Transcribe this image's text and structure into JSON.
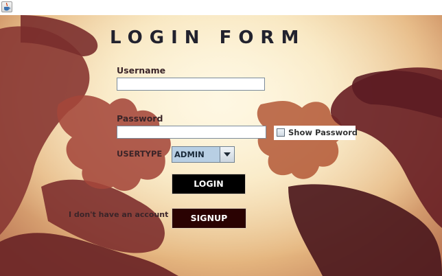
{
  "window": {
    "icon": "java-cup-icon"
  },
  "form": {
    "title": "LOGIN FORM",
    "username_label": "Username",
    "username_value": "",
    "password_label": "Password",
    "password_value": "",
    "show_password_label": "Show Password",
    "show_password_checked": false,
    "usertype_label": "USERTYPE",
    "usertype_selected": "ADMIN",
    "login_label": "LOGIN",
    "account_prompt": "I don't have an account",
    "signup_label": "SIGNUP"
  },
  "colors": {
    "title": "#22222e",
    "login_button": "#000000",
    "signup_button": "#2a0202",
    "combo_background": "#b8cfe4"
  }
}
